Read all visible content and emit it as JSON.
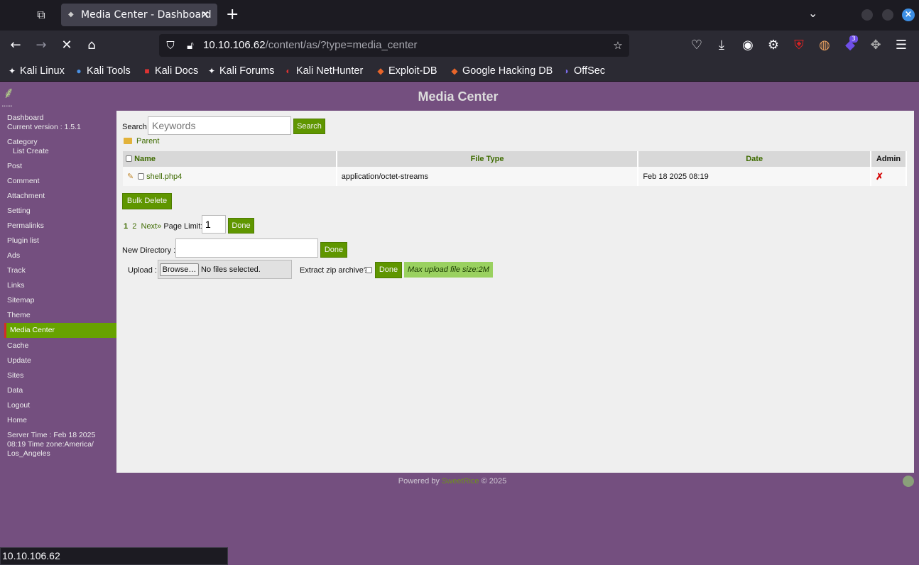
{
  "browser": {
    "tab_title": "Media Center - Dashboard",
    "url_host": "10.10.106.62",
    "url_path": "/content/as/?type=media_center",
    "status_url": "10.10.106.62",
    "ext_badge_count": "3",
    "bookmarks": [
      {
        "label": "Kali Linux",
        "icon": "kali-dragon-icon"
      },
      {
        "label": "Kali Tools",
        "icon": "kali-tools-icon"
      },
      {
        "label": "Kali Docs",
        "icon": "kali-docs-icon"
      },
      {
        "label": "Kali Forums",
        "icon": "kali-dragon-icon"
      },
      {
        "label": "Kali NetHunter",
        "icon": "nethunter-icon"
      },
      {
        "label": "Exploit-DB",
        "icon": "exploit-db-icon"
      },
      {
        "label": "Google Hacking DB",
        "icon": "exploit-db-icon"
      },
      {
        "label": "OffSec",
        "icon": "offsec-icon"
      }
    ]
  },
  "page": {
    "title": "Media Center"
  },
  "sidebar": {
    "dashboard": "Dashboard",
    "version": "Current version : 1.5.1",
    "category": "Category",
    "category_sub": "List Create",
    "items": [
      "Post",
      "Comment",
      "Attachment",
      "Setting",
      "Permalinks",
      "Plugin list",
      "Ads",
      "Track",
      "Links",
      "Sitemap",
      "Theme"
    ],
    "active": "Media Center",
    "items_after": [
      "Cache",
      "Update",
      "Sites",
      "Data",
      "Logout",
      "Home"
    ],
    "server_time": "Server Time : Feb 18 2025 08:19 Time zone:America/ Los_Angeles"
  },
  "media": {
    "search_label": "Search",
    "search_placeholder": "Keywords",
    "search_button": "Search",
    "parent_label": "Parent",
    "columns": {
      "name": "Name",
      "file_type": "File Type",
      "date": "Date",
      "admin": "Admin"
    },
    "rows": [
      {
        "name": "shell.php4",
        "file_type": "application/octet-streams",
        "date": "Feb 18 2025 08:19"
      }
    ],
    "bulk_delete": "Bulk Delete",
    "pages": {
      "current": "1",
      "next_page": "2",
      "next": "Next»",
      "page_limit_label": "Page Limit:",
      "page_limit_value": "1",
      "done": "Done"
    },
    "new_dir_label": "New Directory :",
    "new_dir_done": "Done",
    "upload_label": "Upload :",
    "browse": "Browse…",
    "no_files": "No files selected.",
    "extract_label": "Extract zip archive?",
    "upload_done": "Done",
    "max_upload": "Max upload file size:2M"
  },
  "footer": {
    "powered_by": "Powered by",
    "brand": "SweetRice",
    "year": "© 2025"
  },
  "colors": {
    "page_bg": "#744f7f",
    "accent_green": "#5f9600",
    "active_item": "#67a200"
  }
}
